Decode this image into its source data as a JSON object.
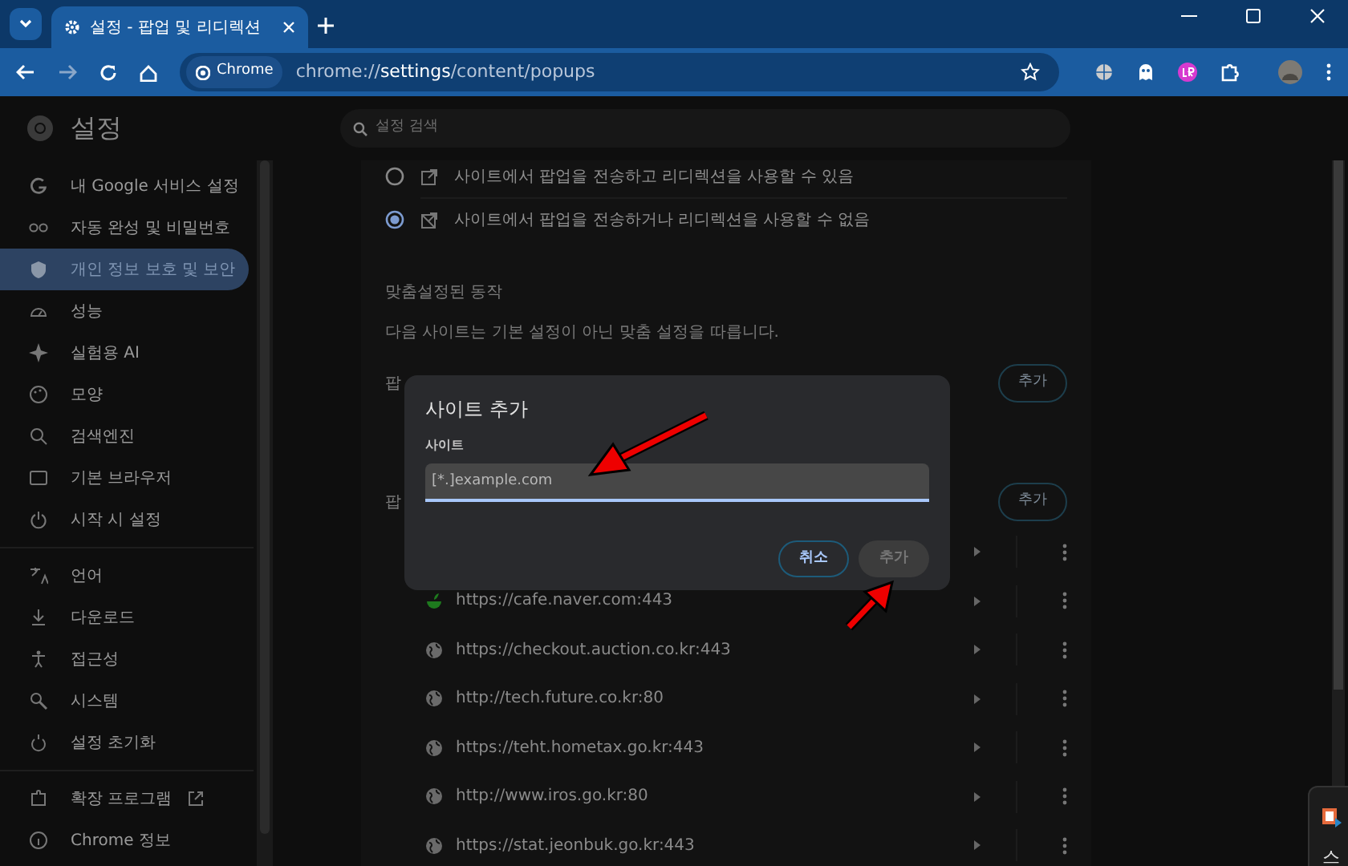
{
  "tab_strip": {
    "tabs": [
      {
        "title": "설정 - 팝업 및 리디렉션",
        "selected": true
      }
    ]
  },
  "toolbar": {
    "chip": "Chrome",
    "url": "chrome://**settings**/content/popups"
  },
  "settings_header": {
    "title": "설정",
    "search_placeholder": "설정 검색"
  },
  "sidebar": {
    "groups": [
      [
        {
          "label": "내 Google 서비스 설정",
          "selected": false,
          "external": false
        },
        {
          "label": "자동 완성 및 비밀번호",
          "selected": false,
          "external": false
        },
        {
          "label": "개인 정보 보호 및 보안",
          "selected": true,
          "external": false
        },
        {
          "label": "성능",
          "selected": false,
          "external": false
        },
        {
          "label": "실험용 AI",
          "selected": false,
          "external": false
        },
        {
          "label": "모양",
          "selected": false,
          "external": false
        },
        {
          "label": "검색엔진",
          "selected": false,
          "external": false
        },
        {
          "label": "기본 브라우저",
          "selected": false,
          "external": false
        },
        {
          "label": "시작 시 설정",
          "selected": false,
          "external": false
        }
      ],
      [
        {
          "label": "언어",
          "selected": false,
          "external": false
        },
        {
          "label": "다운로드",
          "selected": false,
          "external": false
        },
        {
          "label": "접근성",
          "selected": false,
          "external": false
        },
        {
          "label": "시스템",
          "selected": false,
          "external": false
        },
        {
          "label": "설정 초기화",
          "selected": false,
          "external": false
        }
      ],
      [
        {
          "label": "확장 프로그램",
          "selected": false,
          "external": true
        },
        {
          "label": "Chrome 정보",
          "selected": false,
          "external": false
        }
      ]
    ]
  },
  "content": {
    "options": [
      {
        "label": "사이트에서 팝업을 전송하고 리디렉션을 사용할 수 있음",
        "selected": false
      },
      {
        "label": "사이트에서 팝업을 전송하거나 리디렉션을 사용할 수 없음",
        "selected": true
      }
    ],
    "section_title": "맞춤설정된 동작",
    "section_description": "다음 사이트는 기본 설정이 아닌 맞춤 설정을 따릅니다.",
    "lists": [
      {
        "label": "팝",
        "button": "추가"
      },
      {
        "label": "팝",
        "button": "추가"
      }
    ],
    "sites": [
      {
        "kind": "covered"
      },
      {
        "kind": "naver",
        "url": "https://cafe.naver.com:443"
      },
      {
        "kind": "globe",
        "url": "https://checkout.auction.co.kr:443"
      },
      {
        "kind": "globe",
        "url": "http://tech.future.co.kr:80"
      },
      {
        "kind": "globe",
        "url": "https://teht.hometax.go.kr:443"
      },
      {
        "kind": "globe",
        "url": "http://www.iros.go.kr:80"
      },
      {
        "kind": "globe",
        "url": "https://stat.jeonbuk.go.kr:443"
      }
    ]
  },
  "dialog": {
    "title": "사이트 추가",
    "field_label": "사이트",
    "placeholder": "[*.]example.com",
    "buttons": [
      {
        "label": "취소",
        "kind": "cancel",
        "disabled": false
      },
      {
        "label": "추가",
        "kind": "confirm",
        "disabled": true
      }
    ]
  },
  "corner_popup": {
    "text": "스"
  }
}
